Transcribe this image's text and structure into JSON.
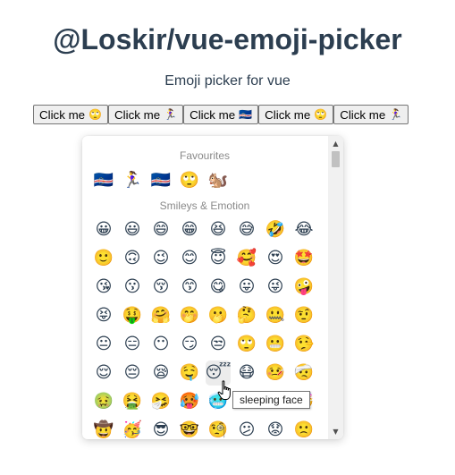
{
  "header": {
    "title": "@Loskir/vue-emoji-picker",
    "subtitle": "Emoji picker for vue"
  },
  "buttons": [
    {
      "label": "Click me",
      "emoji": "🙄"
    },
    {
      "label": "Click me",
      "emoji": "🏃‍♀️"
    },
    {
      "label": "Click me",
      "emoji": "🇨🇻"
    },
    {
      "label": "Click me",
      "emoji": "🙄"
    },
    {
      "label": "Click me",
      "emoji": "🏃‍♀️"
    }
  ],
  "picker": {
    "favourites_title": "Favourites",
    "favourites": [
      "🇨🇻",
      "🏃‍♀️",
      "🇨🇻",
      "🙄",
      "🐿️"
    ],
    "smileys_title": "Smileys & Emotion",
    "smileys": [
      [
        "😀",
        "😃",
        "😄",
        "😁",
        "😆",
        "😅",
        "🤣",
        "😂"
      ],
      [
        "🙂",
        "🙃",
        "😉",
        "😊",
        "😇",
        "🥰",
        "😍",
        "🤩"
      ],
      [
        "😘",
        "😗",
        "😚",
        "😙",
        "😋",
        "😛",
        "😜",
        "🤪"
      ],
      [
        "😝",
        "🤑",
        "🤗",
        "🤭",
        "🫢",
        "🤔",
        "🤐",
        "🤨"
      ],
      [
        "😐",
        "😑",
        "😶",
        "😏",
        "😒",
        "🙄",
        "😬",
        "🤥"
      ],
      [
        "😌",
        "😔",
        "😪",
        "🤤",
        "😴",
        "😷",
        "🤒",
        "🤕"
      ],
      [
        "🤢",
        "🤮",
        "🤧",
        "🥵",
        "🥶",
        "🥴",
        "😵",
        "🤯"
      ],
      [
        "🤠",
        "🥳",
        "😎",
        "🤓",
        "🧐",
        "😕",
        "😟",
        "🙁"
      ]
    ],
    "hovered_emoji": "😴"
  },
  "tooltip": {
    "text": "sleeping face"
  },
  "icons": {
    "scroll_up": "triangle-up",
    "scroll_down": "triangle-down",
    "cursor": "hand-pointer"
  }
}
